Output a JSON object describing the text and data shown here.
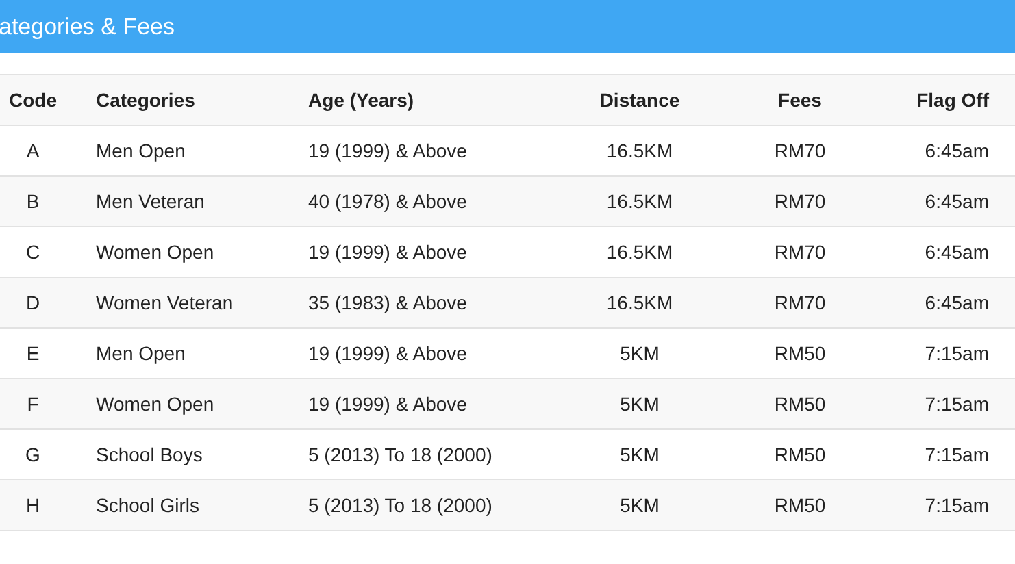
{
  "header": {
    "title": "ategories & Fees"
  },
  "table": {
    "columns": [
      "Code",
      "Categories",
      "Age (Years)",
      "Distance",
      "Fees",
      "Flag Off"
    ],
    "rows": [
      [
        "A",
        "Men Open",
        "19 (1999) & Above",
        "16.5KM",
        "RM70",
        "6:45am"
      ],
      [
        "B",
        "Men Veteran",
        "40 (1978) & Above",
        "16.5KM",
        "RM70",
        "6:45am"
      ],
      [
        "C",
        "Women Open",
        "19 (1999) & Above",
        "16.5KM",
        "RM70",
        "6:45am"
      ],
      [
        "D",
        "Women Veteran",
        "35 (1983) & Above",
        "16.5KM",
        "RM70",
        "6:45am"
      ],
      [
        "E",
        "Men Open",
        "19 (1999) & Above",
        "5KM",
        "RM50",
        "7:15am"
      ],
      [
        "F",
        "Women Open",
        "19 (1999) & Above",
        "5KM",
        "RM50",
        "7:15am"
      ],
      [
        "G",
        "School Boys",
        "5 (2013) To 18 (2000)",
        "5KM",
        "RM50",
        "7:15am"
      ],
      [
        "H",
        "School Girls",
        "5 (2013) To 18 (2000)",
        "5KM",
        "RM50",
        "7:15am"
      ]
    ]
  }
}
